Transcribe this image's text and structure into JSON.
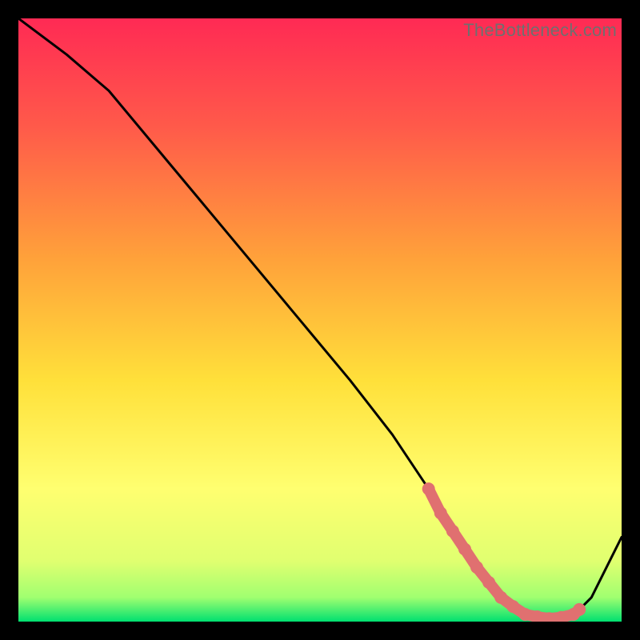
{
  "watermark": "TheBottleneck.com",
  "colors": {
    "gradient_top": "#ff2a54",
    "gradient_mid1": "#ff8a3a",
    "gradient_mid2": "#ffd93a",
    "gradient_mid3": "#ffff66",
    "gradient_bot1": "#d8ff66",
    "gradient_bot2": "#00ff7f",
    "curve": "#000000",
    "marker": "#e07070",
    "bg": "#000000"
  },
  "chart_data": {
    "type": "line",
    "title": "",
    "xlabel": "",
    "ylabel": "",
    "xlim": [
      0,
      100
    ],
    "ylim": [
      0,
      100
    ],
    "series": [
      {
        "name": "bottleneck-curve",
        "x": [
          0,
          8,
          15,
          25,
          35,
          45,
          55,
          62,
          68,
          72,
          76,
          80,
          84,
          88,
          92,
          95,
          100
        ],
        "y": [
          100,
          94,
          88,
          76,
          64,
          52,
          40,
          31,
          22,
          15,
          9,
          4,
          1,
          0.5,
          1,
          4,
          14
        ]
      }
    ],
    "markers": {
      "name": "highlighted-points",
      "x": [
        68,
        70,
        72,
        74,
        76,
        78,
        80,
        82,
        84,
        86,
        88,
        90,
        92,
        93
      ],
      "y": [
        22,
        18,
        15,
        12,
        9,
        6.5,
        4,
        2.5,
        1.2,
        0.8,
        0.5,
        0.7,
        1.2,
        2
      ]
    }
  }
}
